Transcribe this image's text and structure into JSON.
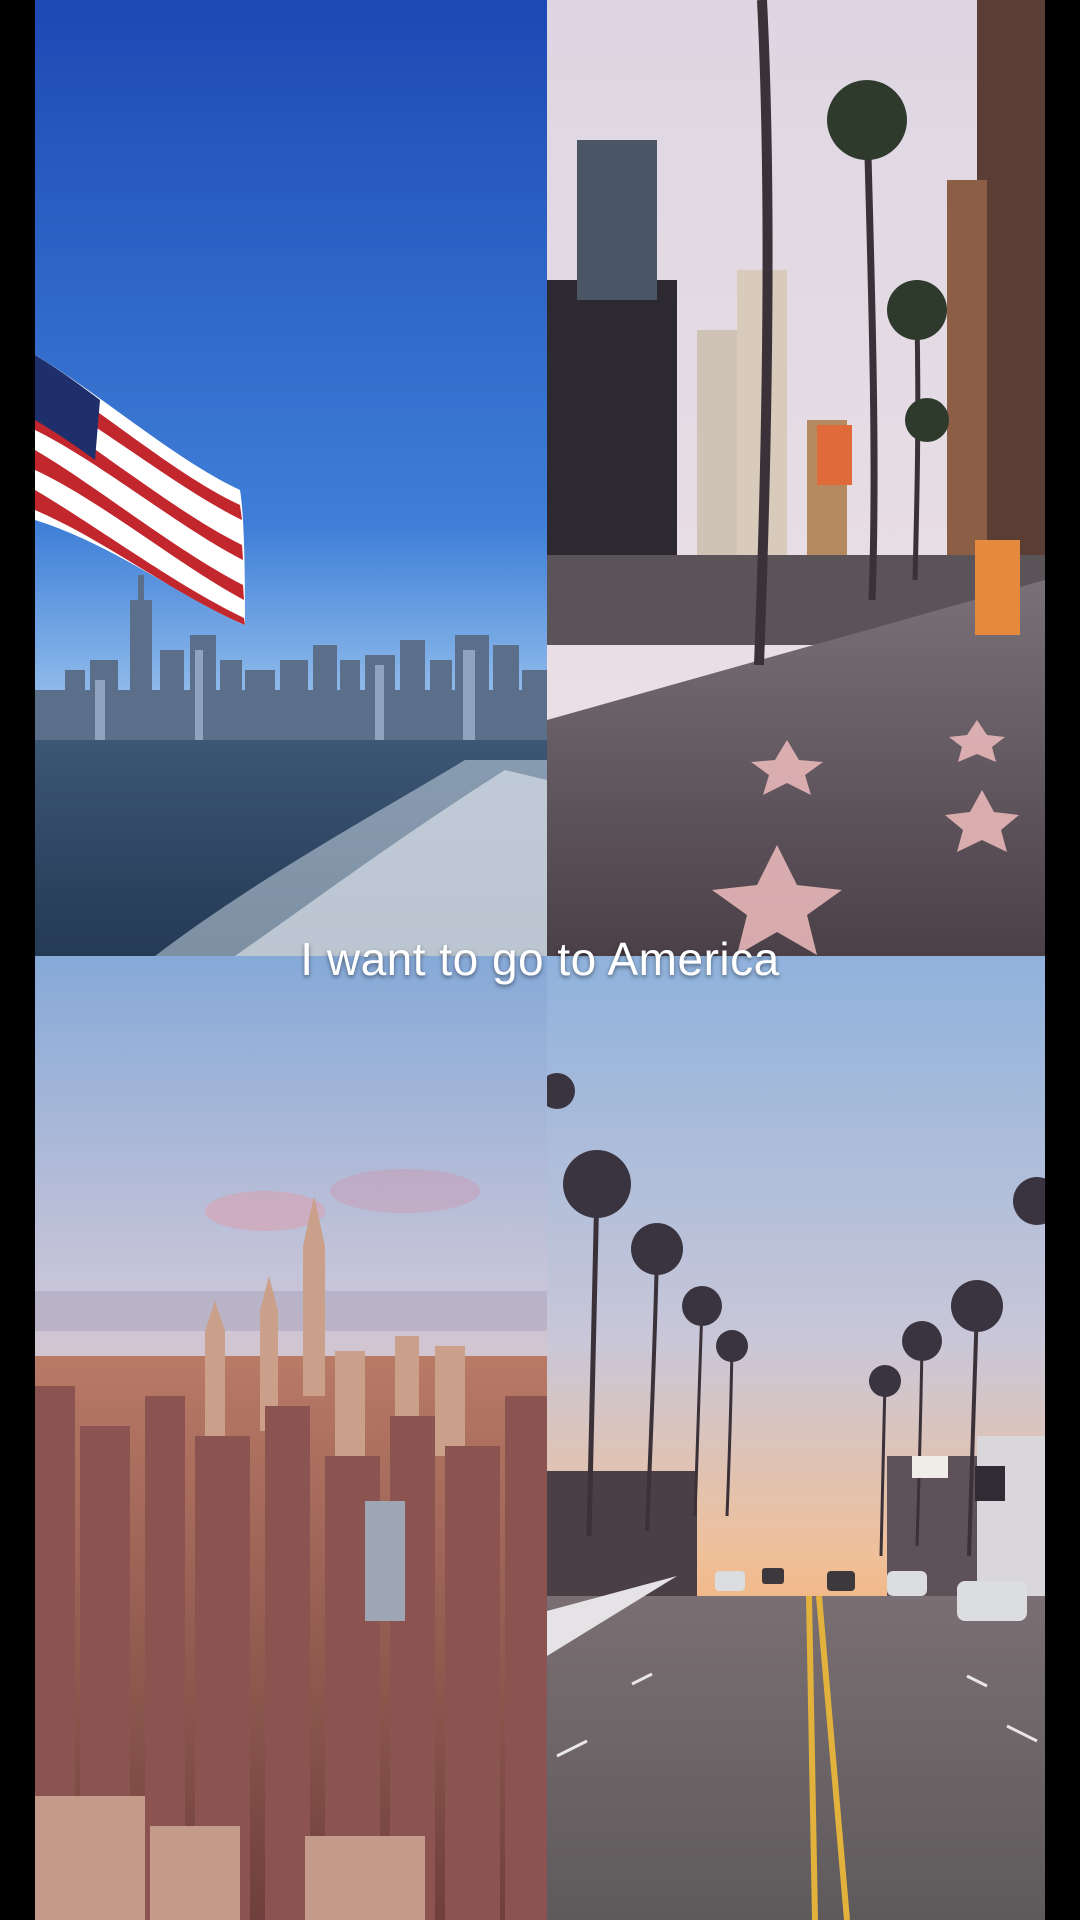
{
  "caption": "I want to go to America",
  "tiles": [
    {
      "scene": "new-york-harbor-flag"
    },
    {
      "scene": "hollywood-walk-of-fame"
    },
    {
      "scene": "manhattan-skyline-sunset"
    },
    {
      "scene": "palm-tree-boulevard-sunset"
    }
  ],
  "colors": {
    "sky_blue": "#2f64c8",
    "sunset_orange": "#f0b27a",
    "pink_haze": "#e9b8c8"
  }
}
